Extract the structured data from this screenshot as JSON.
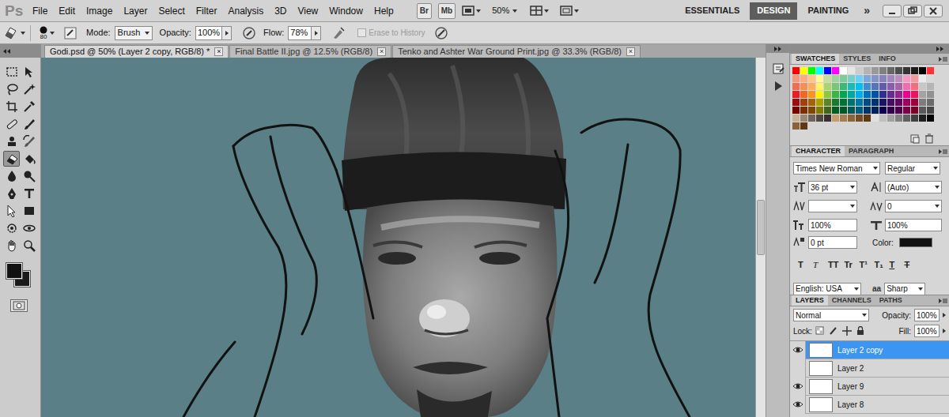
{
  "app": {
    "logo": "Ps",
    "menus": [
      "File",
      "Edit",
      "Image",
      "Layer",
      "Select",
      "Filter",
      "Analysis",
      "3D",
      "View",
      "Window",
      "Help"
    ],
    "bridge": "Br",
    "mini_bridge": "Mb",
    "zoom": "50%",
    "workspaces": [
      {
        "label": "ESSENTIALS",
        "selected": false
      },
      {
        "label": "DESIGN",
        "selected": true
      },
      {
        "label": "PAINTING",
        "selected": false
      }
    ],
    "more": "»"
  },
  "options": {
    "brush_size": "80",
    "mode_label": "Mode:",
    "mode": "Brush",
    "opacity_label": "Opacity:",
    "opacity": "100%",
    "flow_label": "Flow:",
    "flow": "78%",
    "erase_to_history": {
      "label": "Erase to History",
      "checked": false,
      "disabled": true
    }
  },
  "documents": [
    {
      "label": "Godi.psd @ 50% (Layer 2 copy, RGB/8) *",
      "selected": true,
      "close": "×"
    },
    {
      "label": "Final Battle II.jpg @ 12.5% (RGB/8)",
      "selected": false,
      "close": "×"
    },
    {
      "label": "Tenko and Ashter War Ground Print.jpg @ 33.3% (RGB/8)",
      "selected": false,
      "close": "×"
    }
  ],
  "tools": [
    {
      "selected": false
    },
    {
      "selected": false
    },
    {
      "selected": false
    },
    {
      "selected": false
    },
    {
      "selected": false
    },
    {
      "selected": false
    },
    {
      "selected": false
    },
    {
      "selected": false
    },
    {
      "selected": false
    },
    {
      "selected": false
    },
    {
      "selected": true
    },
    {
      "selected": false
    },
    {
      "selected": false
    },
    {
      "selected": false
    },
    {
      "selected": false
    },
    {
      "selected": false
    },
    {
      "selected": false
    },
    {
      "selected": false
    },
    {
      "selected": false
    },
    {
      "selected": false
    },
    {
      "selected": false
    },
    {
      "selected": false
    }
  ],
  "colors": {
    "foreground": "#111111",
    "background": "#1a1a1a"
  },
  "swatches": {
    "tabs": [
      {
        "label": "SWATCHES",
        "selected": true
      },
      {
        "label": "STYLES",
        "selected": false
      },
      {
        "label": "INFO",
        "selected": false
      }
    ],
    "colors": [
      [
        "#ff0000",
        "#ffff00",
        "#00ff00",
        "#00ffff",
        "#0000ff",
        "#ff00ff",
        "#ffffff",
        "#e6e6e6",
        "#cccccc",
        "#b3b3b3",
        "#999999",
        "#808080",
        "#666666",
        "#4d4d4d",
        "#333333",
        "#1a1a1a",
        "#000000",
        "#ff3333"
      ],
      [
        "#f7977a",
        "#f9ad81",
        "#fdc68a",
        "#fff79a",
        "#c4df9b",
        "#a2d39c",
        "#82ca9d",
        "#7bcdc8",
        "#6ecff6",
        "#7ea7d8",
        "#8493ca",
        "#8882be",
        "#a187be",
        "#bc8dbf",
        "#f49ac2",
        "#f6989d",
        "#ebebeb",
        "#d9d9d9"
      ],
      [
        "#f26c4f",
        "#f68e55",
        "#fbaf5c",
        "#fff467",
        "#acd372",
        "#7cc576",
        "#3bb878",
        "#1abbb4",
        "#00bff3",
        "#438ccb",
        "#5574b9",
        "#605ca8",
        "#855fa8",
        "#a763a8",
        "#f06ea9",
        "#f26d7d",
        "#c7c7c7",
        "#b5b5b5"
      ],
      [
        "#ed1c24",
        "#f26522",
        "#f7941d",
        "#fff200",
        "#8dc73f",
        "#39b54a",
        "#00a651",
        "#00a99d",
        "#00aeef",
        "#0072bc",
        "#0054a6",
        "#2e3192",
        "#662d91",
        "#92278f",
        "#ec008c",
        "#ed145b",
        "#a3a3a3",
        "#919191"
      ],
      [
        "#9e0b0f",
        "#a0410d",
        "#a36209",
        "#aba000",
        "#598527",
        "#1a7b30",
        "#007236",
        "#00746b",
        "#0076a3",
        "#004b80",
        "#003471",
        "#1b1464",
        "#440e62",
        "#630460",
        "#9e005d",
        "#9e0039",
        "#7d7d7d",
        "#6b6b6b"
      ],
      [
        "#790000",
        "#7b2e00",
        "#7d4900",
        "#827b00",
        "#406618",
        "#005e20",
        "#005826",
        "#005952",
        "#005b7f",
        "#003663",
        "#002157",
        "#0d004c",
        "#32004b",
        "#4b0049",
        "#7b0046",
        "#7a0026",
        "#595959",
        "#474747"
      ],
      [
        "#c7b299",
        "#998675",
        "#736357",
        "#534741",
        "#37302d",
        "#c69c6d",
        "#a67c52",
        "#8c6239",
        "#754c24",
        "#603913",
        "#e0e0e0",
        "#bfbfbf",
        "#a0a0a0",
        "#808080",
        "#606060",
        "#404040",
        "#202020",
        "#000000"
      ],
      [
        "#8c6239",
        "#603913"
      ]
    ]
  },
  "character": {
    "tabs": [
      {
        "label": "CHARACTER",
        "selected": true
      },
      {
        "label": "PARAGRAPH",
        "selected": false
      }
    ],
    "font": "Times New Roman",
    "style": "Regular",
    "size": "36 pt",
    "leading": "(Auto)",
    "kerning": "",
    "tracking": "0",
    "vertical_scale": "100%",
    "horizontal_scale": "100%",
    "baseline_shift": "0 pt",
    "color_label": "Color:",
    "color": "#111111",
    "styles": [
      {
        "label": "T",
        "kind": "bold"
      },
      {
        "label": "T",
        "kind": "italic"
      },
      {
        "label": "TT",
        "kind": "caps"
      },
      {
        "label": "Tr",
        "kind": "smallcaps"
      },
      {
        "label": "T¹",
        "kind": "super"
      },
      {
        "label": "T₁",
        "kind": "sub"
      },
      {
        "label": "T",
        "kind": "underline"
      },
      {
        "label": "T",
        "kind": "strike"
      }
    ],
    "language": "English: USA",
    "aa": "aa",
    "antialias": "Sharp"
  },
  "layers": {
    "tabs": [
      {
        "label": "LAYERS",
        "selected": true
      },
      {
        "label": "CHANNELS",
        "selected": false
      },
      {
        "label": "PATHS",
        "selected": false
      }
    ],
    "blend": "Normal",
    "opacity_label": "Opacity:",
    "opacity": "100%",
    "lock_label": "Lock:",
    "fill_label": "Fill:",
    "fill": "100%",
    "items": [
      {
        "name": "Layer 2 copy",
        "visible": true,
        "selected": true
      },
      {
        "name": "Layer 2",
        "visible": false,
        "selected": false
      },
      {
        "name": "Layer 9",
        "visible": true,
        "selected": false
      },
      {
        "name": "Layer 8",
        "visible": true,
        "selected": false
      }
    ]
  }
}
